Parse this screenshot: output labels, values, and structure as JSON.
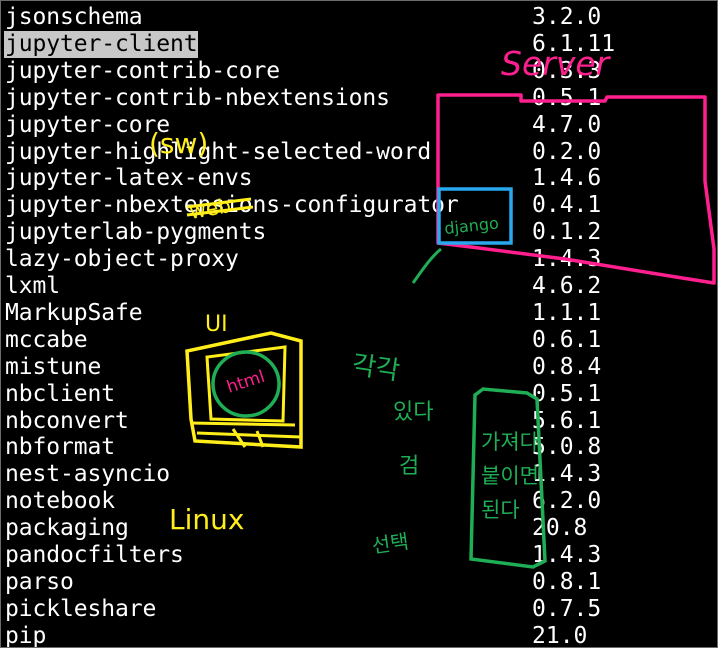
{
  "terminal": {
    "selected_index": 1,
    "packages": [
      {
        "name": "jsonschema",
        "version": "3.2.0"
      },
      {
        "name": "jupyter-client",
        "version": "6.1.11"
      },
      {
        "name": "jupyter-contrib-core",
        "version": "0.3.3"
      },
      {
        "name": "jupyter-contrib-nbextensions",
        "version": "0.5.1"
      },
      {
        "name": "jupyter-core",
        "version": "4.7.0"
      },
      {
        "name": "jupyter-highlight-selected-word",
        "version": "0.2.0"
      },
      {
        "name": "jupyter-latex-envs",
        "version": "1.4.6"
      },
      {
        "name": "jupyter-nbextensions-configurator",
        "version": "0.4.1"
      },
      {
        "name": "jupyterlab-pygments",
        "version": "0.1.2"
      },
      {
        "name": "lazy-object-proxy",
        "version": "1.4.3"
      },
      {
        "name": "lxml",
        "version": "4.6.2"
      },
      {
        "name": "MarkupSafe",
        "version": "1.1.1"
      },
      {
        "name": "mccabe",
        "version": "0.6.1"
      },
      {
        "name": "mistune",
        "version": "0.8.4"
      },
      {
        "name": "nbclient",
        "version": "0.5.1"
      },
      {
        "name": "nbconvert",
        "version": "5.6.1"
      },
      {
        "name": "nbformat",
        "version": "5.0.8"
      },
      {
        "name": "nest-asyncio",
        "version": "1.4.3"
      },
      {
        "name": "notebook",
        "version": "6.2.0"
      },
      {
        "name": "packaging",
        "version": "20.8"
      },
      {
        "name": "pandocfilters",
        "version": "1.4.3"
      },
      {
        "name": "parso",
        "version": "0.8.1"
      },
      {
        "name": "pickleshare",
        "version": "0.7.5"
      },
      {
        "name": "pip",
        "version": "21.0"
      }
    ]
  },
  "annotations": {
    "server": "Server",
    "django": "django",
    "sw": "(sw)",
    "web": "web",
    "linux": "Linux",
    "ui": "UI",
    "html": "html",
    "korean_a": "각각",
    "korean_b": "있다",
    "korean_c": "검",
    "korean_d": "선택",
    "korean_box": "가져다\n붙이면\n된다"
  },
  "colors": {
    "background": "#000000",
    "text": "#ffffff",
    "selection": "#c8c8c8",
    "pink": "#ff1f8e",
    "blue": "#29a8f0",
    "yellow": "#ffee1a",
    "green": "#1fae55"
  }
}
